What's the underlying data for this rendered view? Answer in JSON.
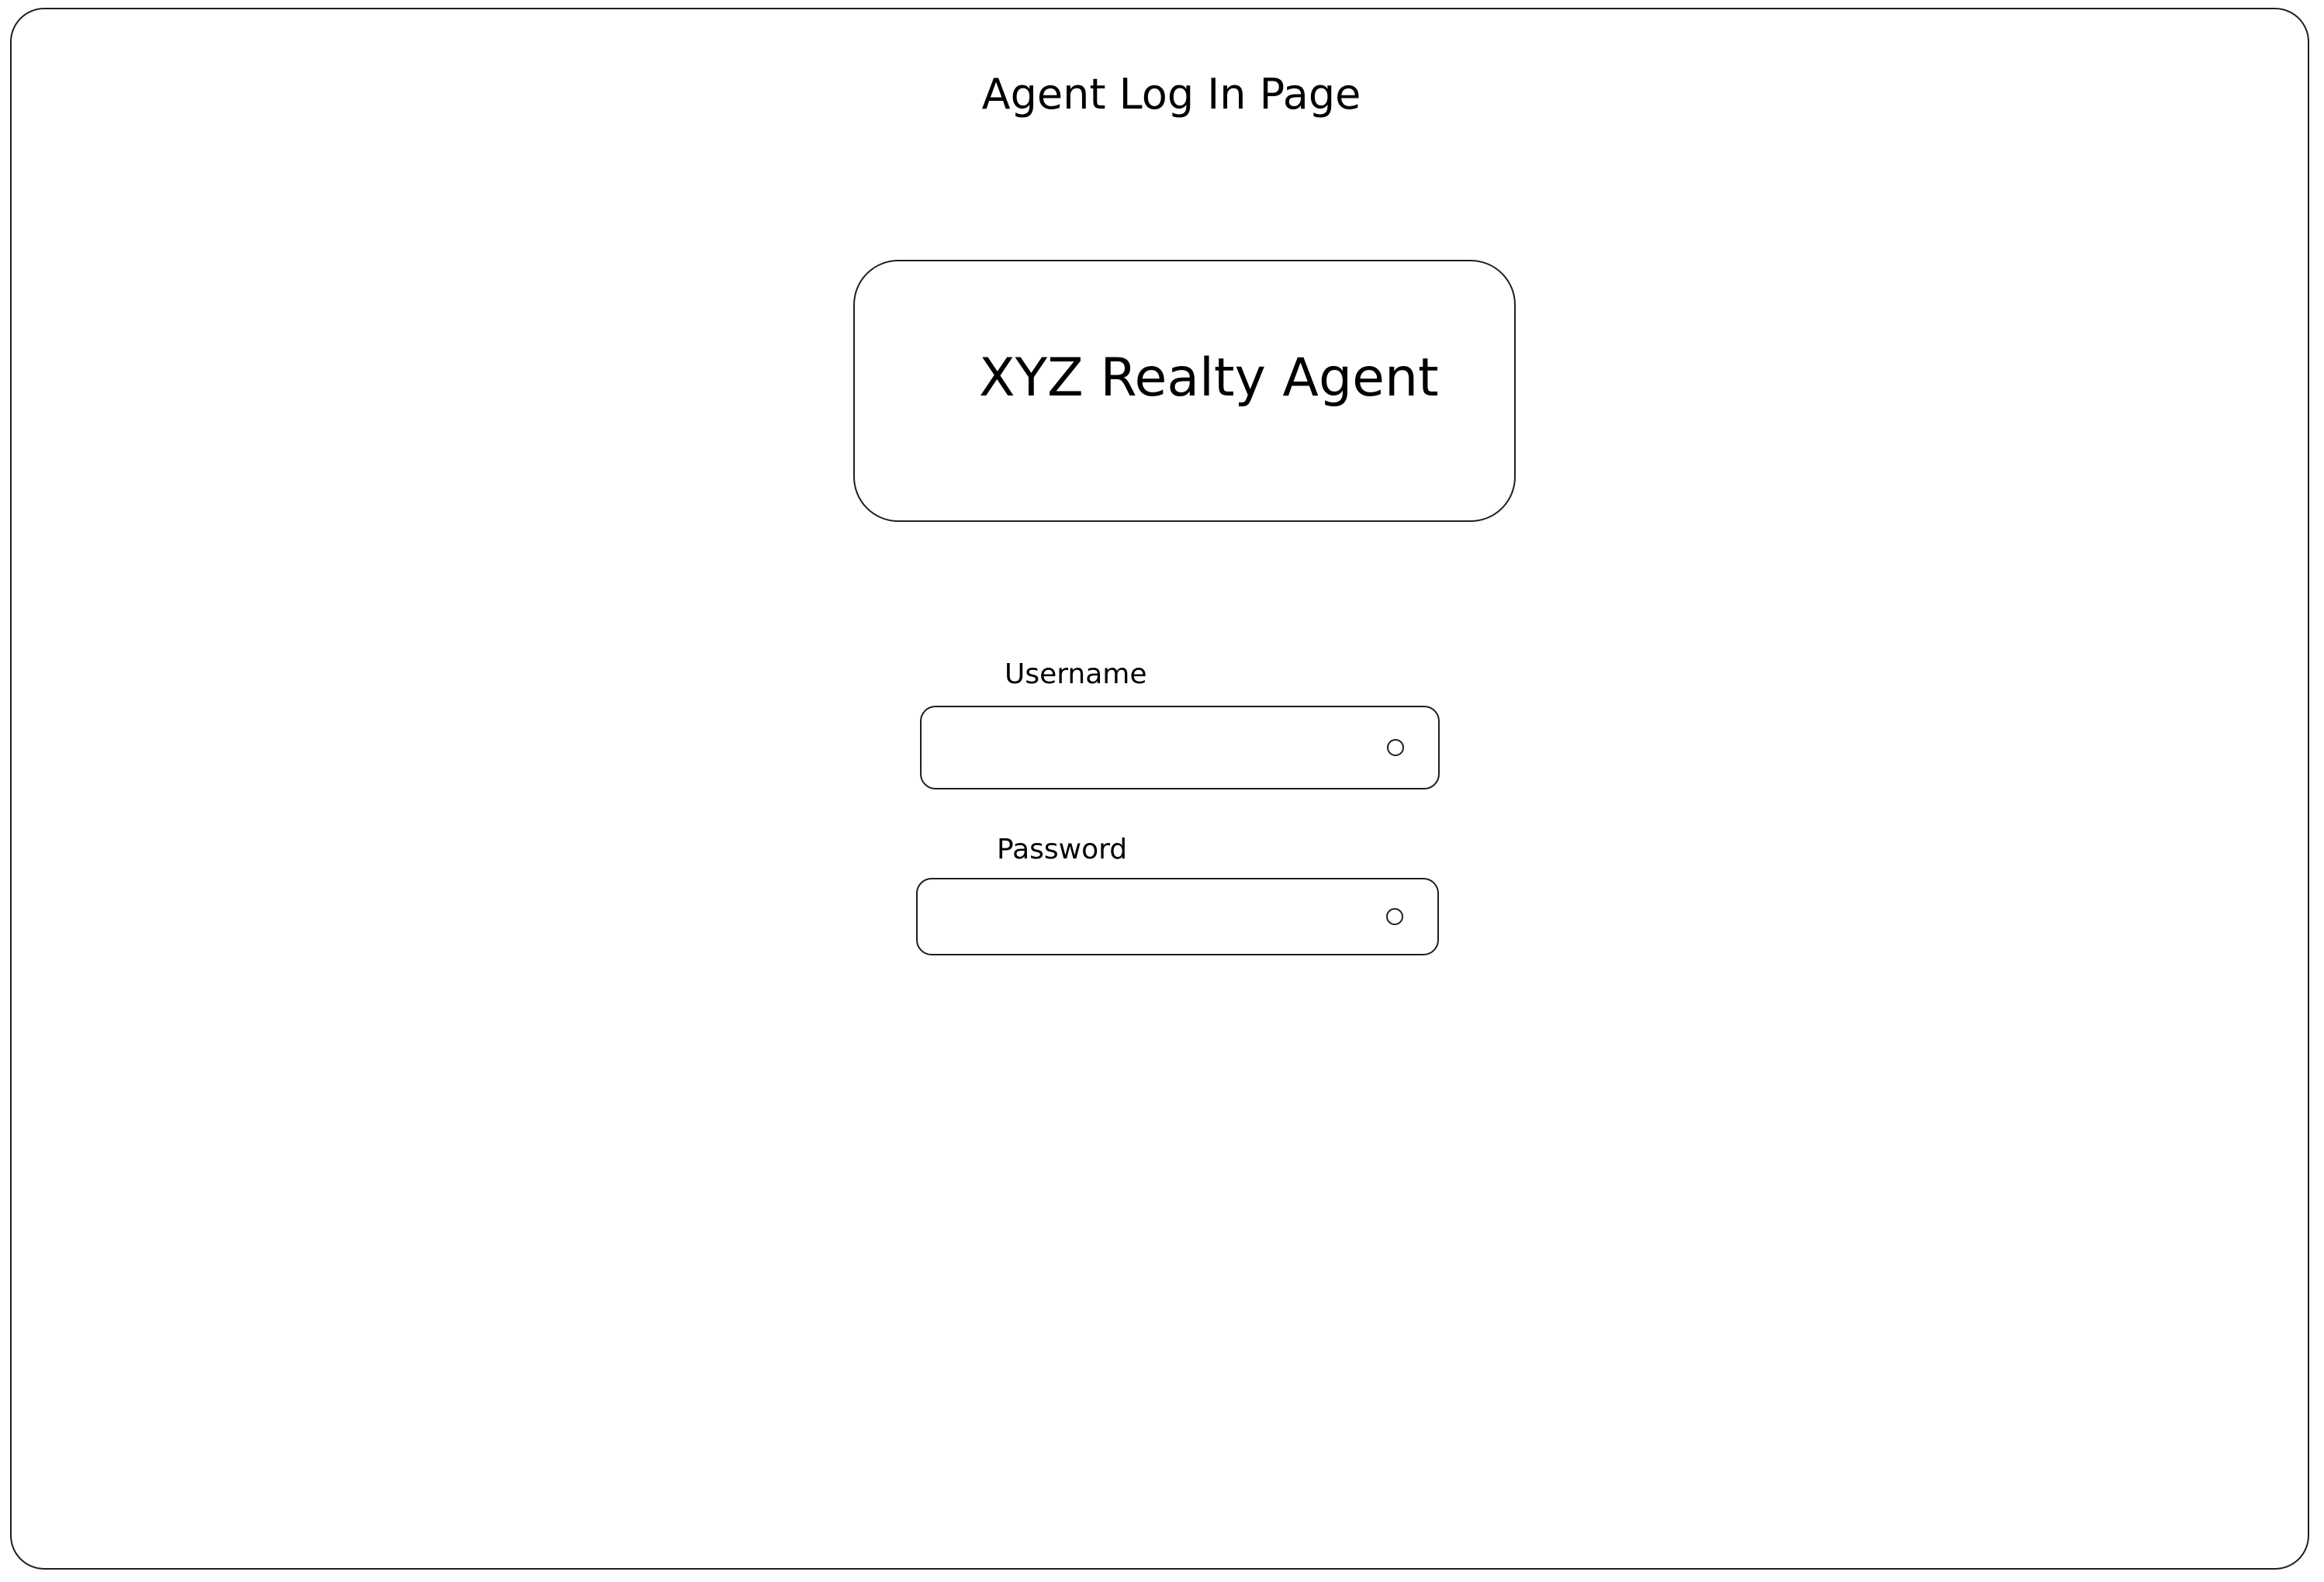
{
  "page": {
    "title": "Agent Log In Page"
  },
  "logo": {
    "text": "XYZ Realty Agent"
  },
  "login_form": {
    "username": {
      "label": "Username",
      "value": "",
      "placeholder": ""
    },
    "password": {
      "label": "Password",
      "value": "",
      "placeholder": ""
    }
  },
  "icons": {
    "username_field_icon": "radio-circle-icon",
    "password_field_icon": "radio-circle-icon"
  },
  "colors": {
    "stroke": "#1e1e1e",
    "background": "#ffffff",
    "text": "#000000"
  }
}
